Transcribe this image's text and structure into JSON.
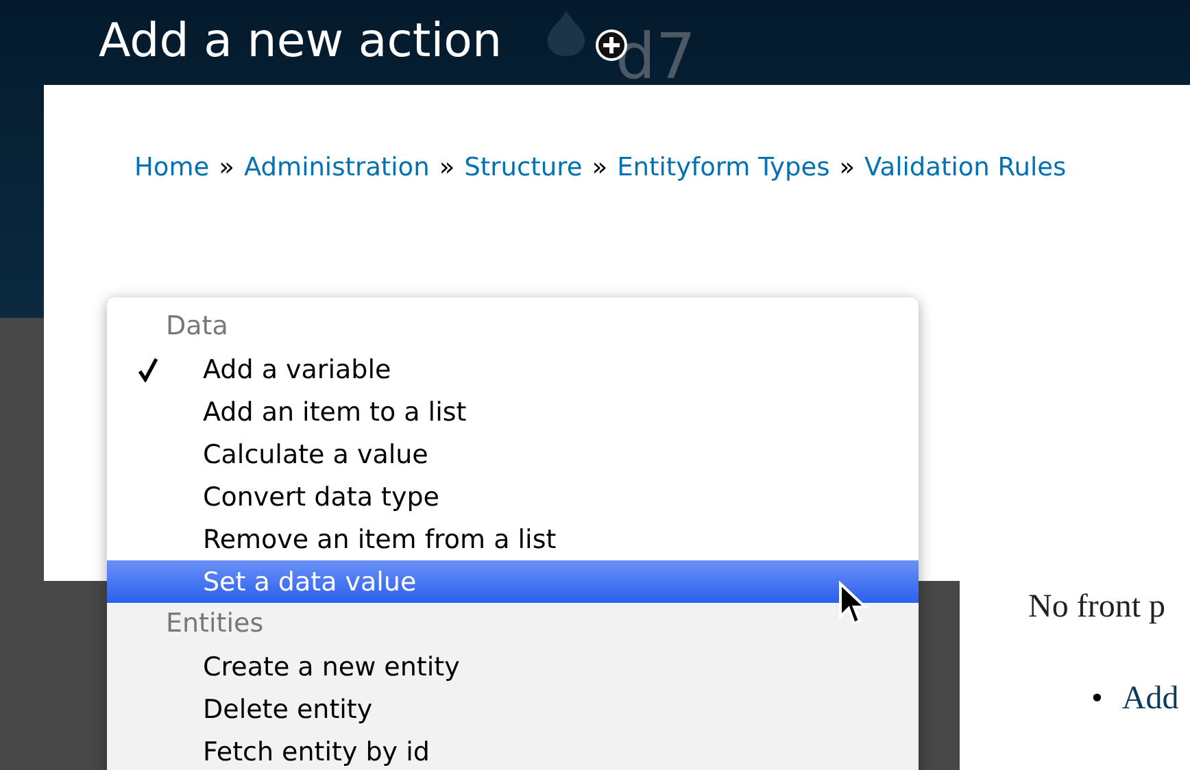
{
  "header": {
    "title": "Add a new action",
    "logo_text": "d7"
  },
  "breadcrumb": [
    {
      "label": "Home",
      "separator": "»"
    },
    {
      "label": "Administration",
      "separator": "»"
    },
    {
      "label": "Structure",
      "separator": "»"
    },
    {
      "label": "Entityform Types",
      "separator": "»"
    },
    {
      "label": "Validation Rules"
    }
  ],
  "menu": {
    "groups": [
      {
        "label": "Data",
        "items": [
          {
            "label": "Add a variable",
            "checked": true,
            "selected": false
          },
          {
            "label": "Add an item to a list",
            "checked": false,
            "selected": false
          },
          {
            "label": "Calculate a value",
            "checked": false,
            "selected": false
          },
          {
            "label": "Convert data type",
            "checked": false,
            "selected": false
          },
          {
            "label": "Remove an item from a list",
            "checked": false,
            "selected": false
          },
          {
            "label": "Set a data value",
            "checked": false,
            "selected": true
          }
        ]
      },
      {
        "label": "Entities",
        "items": [
          {
            "label": "Create a new entity",
            "checked": false,
            "selected": false
          },
          {
            "label": "Delete entity",
            "checked": false,
            "selected": false
          },
          {
            "label": "Fetch entity by id",
            "checked": false,
            "selected": false
          }
        ]
      }
    ]
  },
  "page": {
    "text": "No front p",
    "links": [
      {
        "bullet": "•",
        "label": "Add"
      }
    ]
  }
}
